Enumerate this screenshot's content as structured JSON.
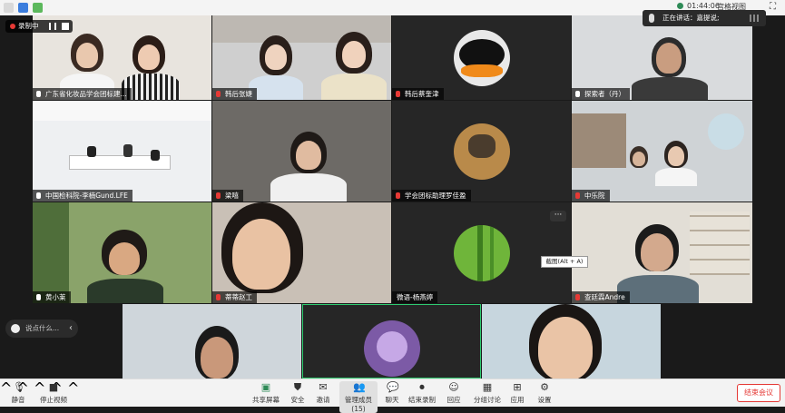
{
  "topbar": {
    "time": "01:44:06",
    "view_label": "宫格视图"
  },
  "recording": {
    "label": "录制中"
  },
  "speaking": {
    "label": "正在讲话：嘉提说;"
  },
  "tiles": [
    {
      "name": "广东省化妆品学会团标建...",
      "mic": "on"
    },
    {
      "name": "韩后张婕",
      "mic": "off"
    },
    {
      "name": "韩后蔡奎津",
      "mic": "off"
    },
    {
      "name": "探索者（丹）",
      "mic": "on"
    },
    {
      "name": "中国检科院-李楠Gund.LFE",
      "mic": "on"
    },
    {
      "name": "梁嘻",
      "mic": "off"
    },
    {
      "name": "学会团标助理罗佳盈",
      "mic": "off"
    },
    {
      "name": "中乐院",
      "mic": "off"
    },
    {
      "name": "黄小莱",
      "mic": "on"
    },
    {
      "name": "蒂蒂赵工",
      "mic": "off"
    },
    {
      "name": "微语-杨燕婷",
      "mic": "none"
    },
    {
      "name": "查廷霖Andre",
      "mic": "off"
    }
  ],
  "tooltip": "截图(Alt + A)",
  "more_label": "···",
  "chat": {
    "placeholder": "说点什么..."
  },
  "toolbar": {
    "mute": "静音",
    "stop_video": "停止视频",
    "share_screen": "共享屏幕",
    "security": "安全",
    "invite": "邀请",
    "participants": "管理成员(15)",
    "chat": "聊天",
    "recording": "结束录制",
    "reactions": "回应",
    "breakout": "分组讨论",
    "apps": "应用",
    "settings": "设置",
    "end_meeting": "结束会议"
  },
  "colors": {
    "accent_green": "#2ecc71",
    "end_red": "#e53935"
  }
}
